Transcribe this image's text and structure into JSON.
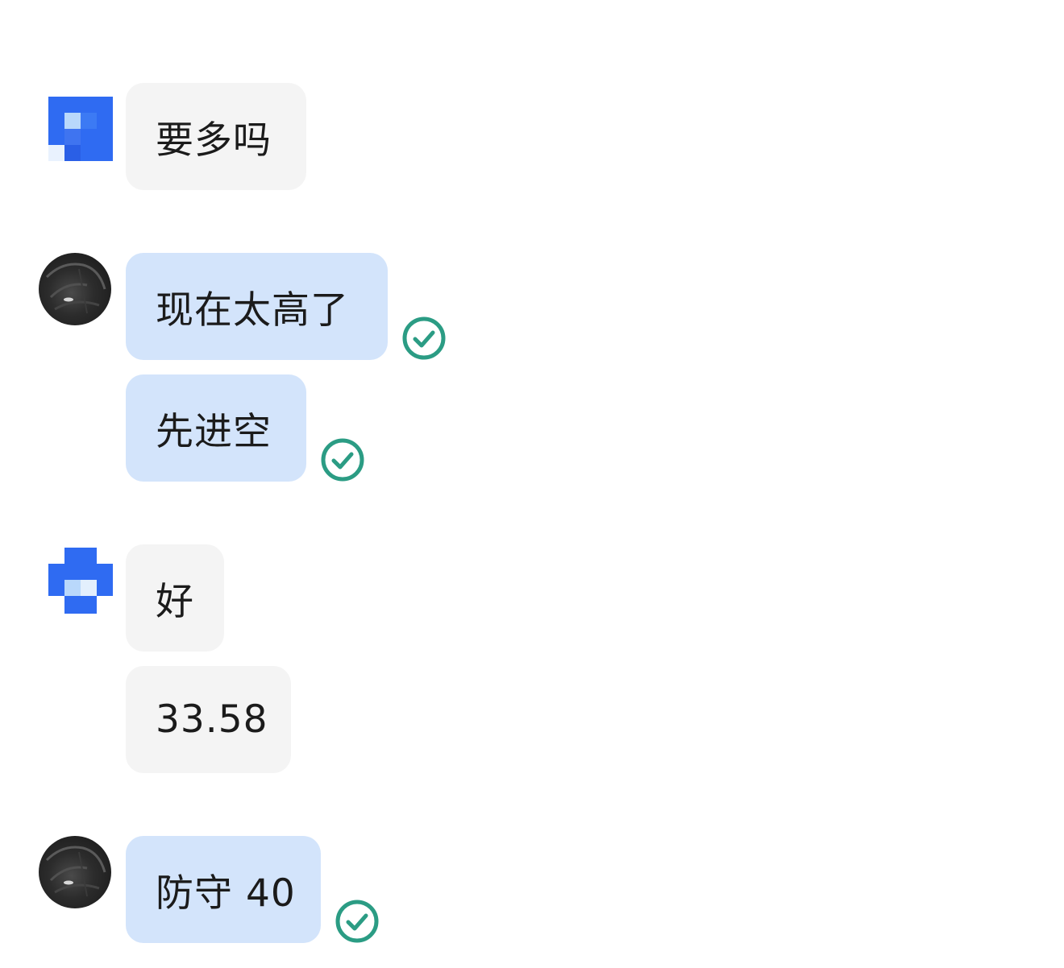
{
  "messages": [
    {
      "side": "incoming",
      "avatar": "blue-pixel-avatar",
      "text": "要多吗"
    },
    {
      "side": "outgoing",
      "avatar": "dark-round-avatar",
      "text": "现在太高了",
      "read": true
    },
    {
      "side": "outgoing",
      "text": "先进空",
      "read": true
    },
    {
      "side": "incoming",
      "avatar": "blue-pixel-avatar",
      "text": "好"
    },
    {
      "side": "incoming",
      "text": "33.58"
    },
    {
      "side": "outgoing",
      "avatar": "dark-round-avatar",
      "text": "防守 40",
      "read": true
    }
  ],
  "colors": {
    "incoming_bubble": "#f4f4f4",
    "outgoing_bubble": "#d3e4fb",
    "read_check": "#2b9c84",
    "avatar_blue": "#2f6bf2"
  }
}
